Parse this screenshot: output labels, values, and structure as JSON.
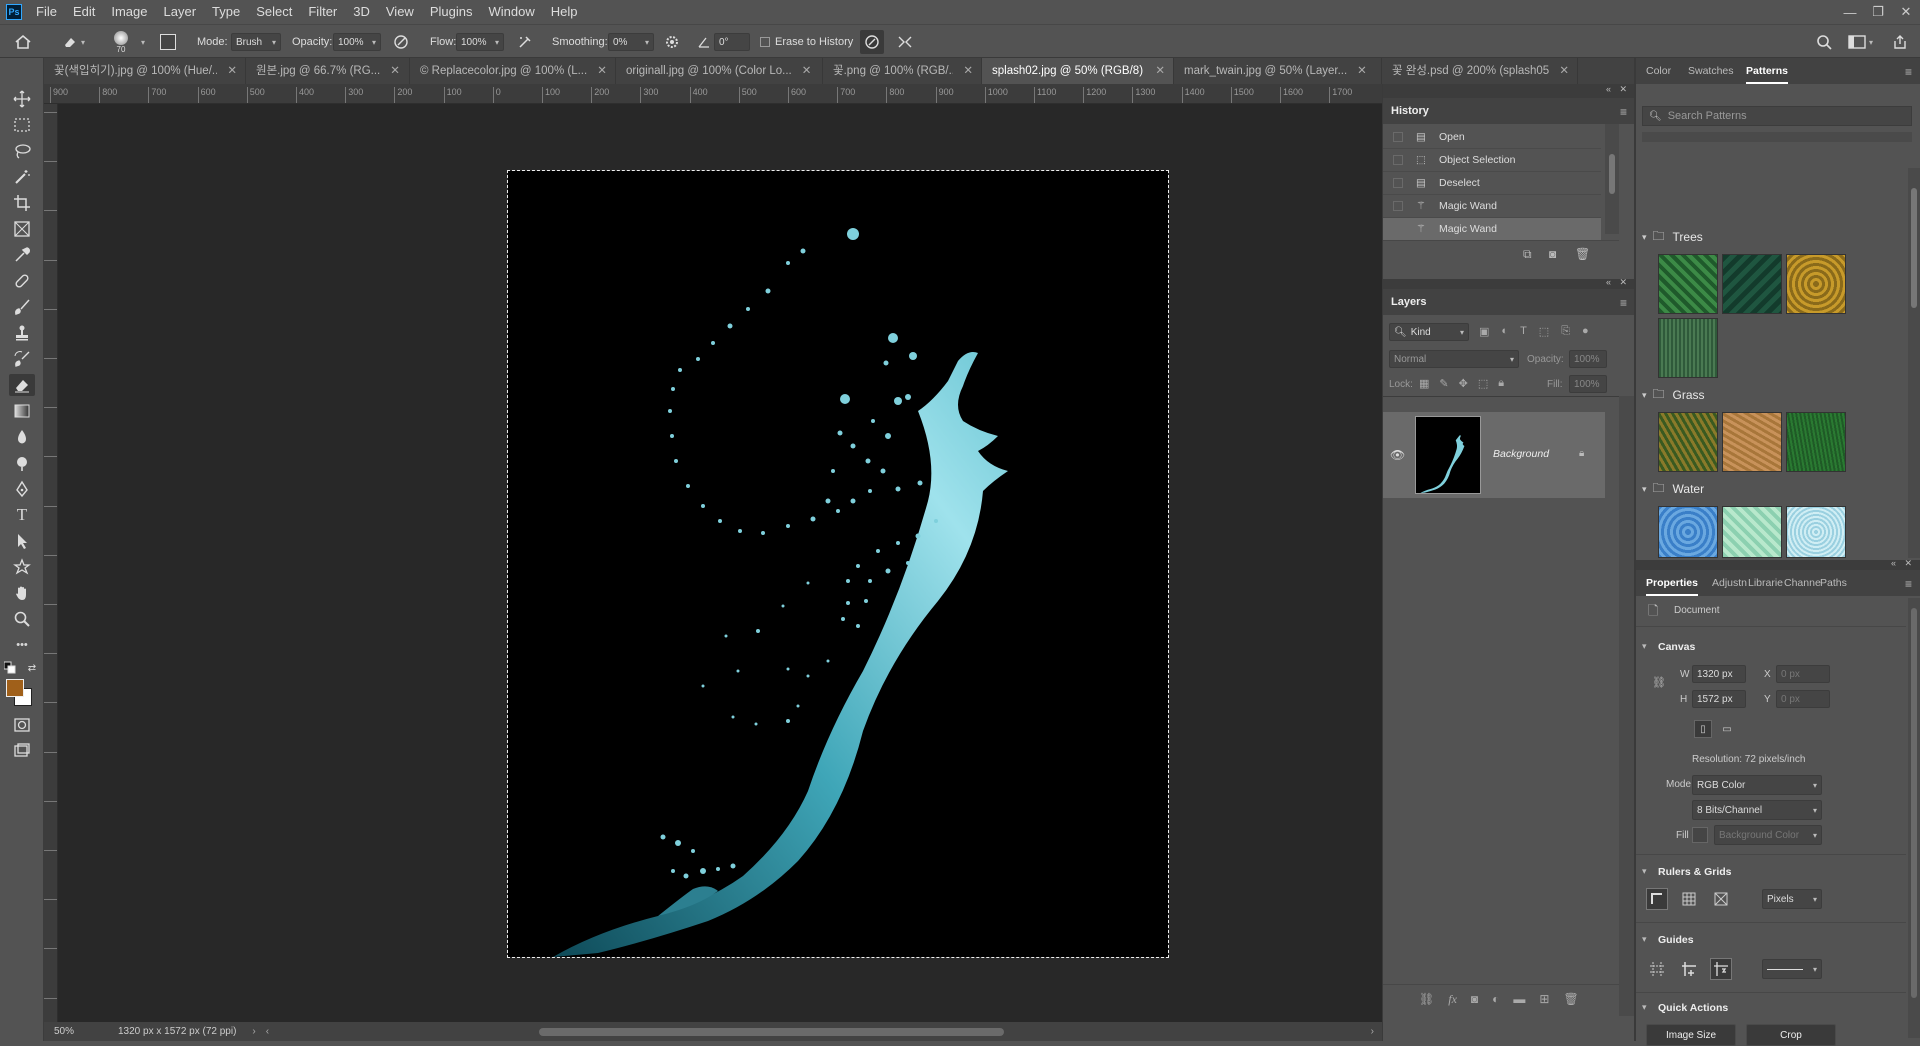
{
  "menubar": {
    "logo": "Ps",
    "items": [
      "File",
      "Edit",
      "Image",
      "Layer",
      "Type",
      "Select",
      "Filter",
      "3D",
      "View",
      "Plugins",
      "Window",
      "Help"
    ]
  },
  "options": {
    "brush_size": "70",
    "mode_label": "Mode:",
    "mode_value": "Brush",
    "opacity_label": "Opacity:",
    "opacity_value": "100%",
    "flow_label": "Flow:",
    "flow_value": "100%",
    "smoothing_label": "Smoothing:",
    "smoothing_value": "0%",
    "angle_value": "0°",
    "erase_history_label": "Erase to History"
  },
  "tabs": [
    {
      "label": "꽃(색입히기).jpg @ 100% (Hue/..."
    },
    {
      "label": "원본.jpg @ 66.7% (RG..."
    },
    {
      "label": "© Replacecolor.jpg @ 100% (L..."
    },
    {
      "label": "originall.jpg @ 100% (Color Lo..."
    },
    {
      "label": "꽃.png @ 100% (RGB/..."
    },
    {
      "label": "splash02.jpg @ 50% (RGB/8) *"
    },
    {
      "label": "mark_twain.jpg @ 50% (Layer..."
    },
    {
      "label": "꽃 완성.psd @ 200% (splash05,..."
    }
  ],
  "ruler": {
    "h_ticks": [
      "900",
      "800",
      "700",
      "600",
      "500",
      "400",
      "300",
      "200",
      "100",
      "0",
      "100",
      "200",
      "300",
      "400",
      "500",
      "600",
      "700",
      "800",
      "900",
      "1000",
      "1100",
      "1200",
      "1300",
      "1400",
      "1500",
      "1600",
      "1700"
    ]
  },
  "status": {
    "zoom": "50%",
    "doc_info": "1320 px x 1572 px (72 ppi)"
  },
  "history": {
    "title": "History",
    "items": [
      "Open",
      "Object Selection",
      "Deselect",
      "Magic Wand",
      "Magic Wand"
    ]
  },
  "layers": {
    "title": "Layers",
    "kind_label": "Kind",
    "blend_mode": "Normal",
    "opacity_label": "Opacity:",
    "opacity_value": "100%",
    "lock_label": "Lock:",
    "fill_label": "Fill:",
    "fill_value": "100%",
    "layer_name": "Background"
  },
  "right_tabs": {
    "color": "Color",
    "swatches": "Swatches",
    "patterns": "Patterns",
    "search_placeholder": "Search Patterns"
  },
  "patterns": {
    "groups": [
      {
        "name": "Trees",
        "colors": [
          "#1f5a2b",
          "#133b2c",
          "#8a6a1a",
          "#2f5a3a"
        ]
      },
      {
        "name": "Grass",
        "colors": [
          "#8a7a2a",
          "#a8763a",
          "#2a7a32"
        ]
      },
      {
        "name": "Water",
        "colors": [
          "#3a7fc8",
          "#8cd0b0",
          "#9ad0e0"
        ]
      }
    ]
  },
  "properties": {
    "tabs": [
      "Properties",
      "Adjustn",
      "Librarie",
      "Channe",
      "Paths"
    ],
    "document_label": "Document",
    "canvas_header": "Canvas",
    "w_label": "W",
    "w_value": "1320 px",
    "h_label": "H",
    "h_value": "1572 px",
    "x_label": "X",
    "x_placeholder": "0 px",
    "y_label": "Y",
    "y_placeholder": "0 px",
    "resolution": "Resolution: 72 pixels/inch",
    "mode_label": "Mode",
    "mode_value": "RGB Color",
    "bits_value": "8 Bits/Channel",
    "fill_label": "Fill",
    "fill_value": "Background Color",
    "rulers_header": "Rulers & Grids",
    "units_value": "Pixels",
    "guides_header": "Guides",
    "quick_header": "Quick Actions",
    "image_size_btn": "Image Size",
    "crop_btn": "Crop"
  },
  "colors": {
    "foreground": "#a0601a",
    "background": "#ffffff",
    "splash": "#7fd0dc"
  }
}
